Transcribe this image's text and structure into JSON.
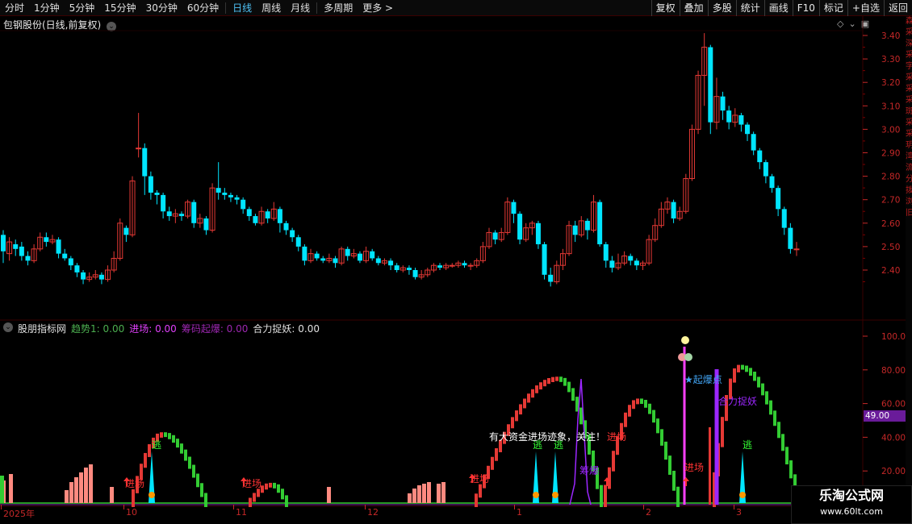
{
  "toolbar": {
    "tabs": [
      "分时",
      "1分钟",
      "5分钟",
      "15分钟",
      "30分钟",
      "60分钟",
      "日线",
      "周线",
      "月线",
      "多周期",
      "更多 >"
    ],
    "active_tab": "日线",
    "right_buttons": [
      "复权",
      "叠加",
      "多股",
      "统计",
      "画线",
      "F10",
      "标记",
      "+自选",
      "返回"
    ]
  },
  "stock": {
    "title": "包钢股份(日线,前复权)"
  },
  "price_axis": [
    "3.40",
    "3.30",
    "3.20",
    "3.10",
    "3.00",
    "2.90",
    "2.80",
    "2.70",
    "2.60",
    "2.50",
    "2.40"
  ],
  "indicator": {
    "name": "股朋指标网",
    "fields": [
      {
        "label": "趋势1: 0.00",
        "color": "#4caf50"
      },
      {
        "label": "进场: 0.00",
        "color": "#e040fb"
      },
      {
        "label": "筹码起爆: 0.00",
        "color": "#9c27b0"
      },
      {
        "label": "合力捉妖: 0.00",
        "color": "#e0e0e0"
      }
    ],
    "axis": [
      "100.0",
      "80.00",
      "60.00",
      "40.00",
      "20.00"
    ],
    "current_value": "49.00",
    "annotations": {
      "escape": "逃",
      "enter": "进场",
      "chip": "筹爆",
      "qibao": "★起爆点",
      "helizhuoyao": "合力捉妖",
      "message_white": "有大资金进场迹象，关注！",
      "message_red": "进场"
    }
  },
  "dates": [
    "2025年",
    "10",
    "11",
    "12",
    "1",
    "2",
    "3"
  ],
  "right_strip": [
    "森",
    "采",
    "深",
    "采",
    "字",
    "采",
    "采",
    "采",
    "斑",
    "采",
    "采",
    "玥",
    "湾",
    "流",
    "分",
    "拨",
    "浏",
    "旧"
  ],
  "watermark": {
    "line1": "乐淘公式网",
    "line2": "www.60lt.com"
  },
  "colors": {
    "up": "#e53935",
    "down": "#00e5ff",
    "grid": "#3a0000",
    "trend_up": "#e53935",
    "trend_down": "#33cc33"
  },
  "chart_data": {
    "type": "candlestick",
    "price_range": [
      2.35,
      3.45
    ],
    "candles": [
      [
        2.55,
        2.48,
        2.57,
        2.43
      ],
      [
        2.47,
        2.52,
        2.54,
        2.44
      ],
      [
        2.51,
        2.49,
        2.53,
        2.46
      ],
      [
        2.5,
        2.46,
        2.52,
        2.44
      ],
      [
        2.46,
        2.44,
        2.48,
        2.42
      ],
      [
        2.44,
        2.49,
        2.51,
        2.43
      ],
      [
        2.49,
        2.54,
        2.56,
        2.48
      ],
      [
        2.54,
        2.52,
        2.56,
        2.5
      ],
      [
        2.52,
        2.53,
        2.55,
        2.51
      ],
      [
        2.53,
        2.47,
        2.54,
        2.45
      ],
      [
        2.47,
        2.45,
        2.49,
        2.44
      ],
      [
        2.45,
        2.42,
        2.46,
        2.4
      ],
      [
        2.42,
        2.39,
        2.43,
        2.37
      ],
      [
        2.39,
        2.36,
        2.4,
        2.34
      ],
      [
        2.36,
        2.37,
        2.39,
        2.35
      ],
      [
        2.37,
        2.38,
        2.4,
        2.36
      ],
      [
        2.38,
        2.36,
        2.39,
        2.34
      ],
      [
        2.36,
        2.4,
        2.42,
        2.35
      ],
      [
        2.4,
        2.45,
        2.48,
        2.39
      ],
      [
        2.45,
        2.6,
        2.62,
        2.44
      ],
      [
        2.58,
        2.55,
        2.59,
        2.52
      ],
      [
        2.55,
        2.78,
        2.8,
        2.54
      ],
      [
        2.92,
        2.92,
        3.07,
        2.88
      ],
      [
        2.92,
        2.8,
        2.94,
        2.72
      ],
      [
        2.8,
        2.73,
        2.82,
        2.7
      ],
      [
        2.73,
        2.72,
        2.74,
        2.68
      ],
      [
        2.72,
        2.65,
        2.73,
        2.62
      ],
      [
        2.65,
        2.63,
        2.67,
        2.61
      ],
      [
        2.63,
        2.64,
        2.66,
        2.6
      ],
      [
        2.64,
        2.63,
        2.65,
        2.61
      ],
      [
        2.63,
        2.69,
        2.7,
        2.62
      ],
      [
        2.69,
        2.6,
        2.7,
        2.58
      ],
      [
        2.6,
        2.62,
        2.64,
        2.58
      ],
      [
        2.62,
        2.57,
        2.63,
        2.55
      ],
      [
        2.57,
        2.75,
        2.77,
        2.56
      ],
      [
        2.75,
        2.73,
        2.86,
        2.7
      ],
      [
        2.73,
        2.72,
        2.75,
        2.7
      ],
      [
        2.72,
        2.71,
        2.73,
        2.69
      ],
      [
        2.71,
        2.7,
        2.72,
        2.68
      ],
      [
        2.7,
        2.66,
        2.71,
        2.64
      ],
      [
        2.66,
        2.63,
        2.67,
        2.61
      ],
      [
        2.63,
        2.6,
        2.64,
        2.59
      ],
      [
        2.6,
        2.65,
        2.67,
        2.59
      ],
      [
        2.65,
        2.62,
        2.66,
        2.6
      ],
      [
        2.62,
        2.66,
        2.69,
        2.61
      ],
      [
        2.66,
        2.6,
        2.67,
        2.56
      ],
      [
        2.6,
        2.57,
        2.61,
        2.55
      ],
      [
        2.57,
        2.54,
        2.58,
        2.52
      ],
      [
        2.54,
        2.5,
        2.55,
        2.48
      ],
      [
        2.5,
        2.44,
        2.51,
        2.42
      ],
      [
        2.44,
        2.47,
        2.49,
        2.43
      ],
      [
        2.47,
        2.45,
        2.48,
        2.44
      ],
      [
        2.45,
        2.44,
        2.46,
        2.43
      ],
      [
        2.44,
        2.45,
        2.47,
        2.43
      ],
      [
        2.45,
        2.43,
        2.46,
        2.41
      ],
      [
        2.43,
        2.49,
        2.5,
        2.42
      ],
      [
        2.49,
        2.46,
        2.5,
        2.44
      ],
      [
        2.46,
        2.47,
        2.49,
        2.45
      ],
      [
        2.47,
        2.44,
        2.48,
        2.43
      ],
      [
        2.44,
        2.48,
        2.5,
        2.43
      ],
      [
        2.48,
        2.45,
        2.49,
        2.44
      ],
      [
        2.45,
        2.43,
        2.46,
        2.42
      ],
      [
        2.43,
        2.44,
        2.45,
        2.42
      ],
      [
        2.44,
        2.42,
        2.45,
        2.4
      ],
      [
        2.42,
        2.4,
        2.43,
        2.39
      ],
      [
        2.4,
        2.41,
        2.42,
        2.39
      ],
      [
        2.41,
        2.4,
        2.42,
        2.38
      ],
      [
        2.4,
        2.37,
        2.41,
        2.36
      ],
      [
        2.37,
        2.38,
        2.4,
        2.36
      ],
      [
        2.38,
        2.4,
        2.41,
        2.37
      ],
      [
        2.4,
        2.42,
        2.43,
        2.39
      ],
      [
        2.42,
        2.41,
        2.43,
        2.4
      ],
      [
        2.41,
        2.42,
        2.43,
        2.4
      ],
      [
        2.42,
        2.42,
        2.43,
        2.41
      ],
      [
        2.42,
        2.43,
        2.44,
        2.41
      ],
      [
        2.43,
        2.42,
        2.44,
        2.41
      ],
      [
        2.42,
        2.42,
        2.43,
        2.4
      ],
      [
        2.42,
        2.44,
        2.45,
        2.41
      ],
      [
        2.44,
        2.5,
        2.52,
        2.43
      ],
      [
        2.5,
        2.56,
        2.58,
        2.49
      ],
      [
        2.56,
        2.53,
        2.57,
        2.51
      ],
      [
        2.53,
        2.56,
        2.58,
        2.52
      ],
      [
        2.56,
        2.69,
        2.71,
        2.55
      ],
      [
        2.69,
        2.64,
        2.7,
        2.6
      ],
      [
        2.64,
        2.53,
        2.65,
        2.51
      ],
      [
        2.53,
        2.58,
        2.6,
        2.52
      ],
      [
        2.58,
        2.6,
        2.61,
        2.55
      ],
      [
        2.6,
        2.51,
        2.61,
        2.49
      ],
      [
        2.51,
        2.38,
        2.52,
        2.36
      ],
      [
        2.38,
        2.35,
        2.41,
        2.33
      ],
      [
        2.35,
        2.42,
        2.44,
        2.34
      ],
      [
        2.42,
        2.47,
        2.49,
        2.4
      ],
      [
        2.47,
        2.59,
        2.61,
        2.46
      ],
      [
        2.59,
        2.55,
        2.61,
        2.52
      ],
      [
        2.55,
        2.61,
        2.63,
        2.54
      ],
      [
        2.61,
        2.57,
        2.62,
        2.53
      ],
      [
        2.57,
        2.69,
        2.72,
        2.56
      ],
      [
        2.69,
        2.51,
        2.7,
        2.5
      ],
      [
        2.51,
        2.44,
        2.52,
        2.41
      ],
      [
        2.44,
        2.41,
        2.46,
        2.39
      ],
      [
        2.41,
        2.43,
        2.47,
        2.4
      ],
      [
        2.43,
        2.46,
        2.48,
        2.42
      ],
      [
        2.46,
        2.44,
        2.47,
        2.42
      ],
      [
        2.44,
        2.42,
        2.45,
        2.4
      ],
      [
        2.42,
        2.43,
        2.44,
        2.4
      ],
      [
        2.43,
        2.53,
        2.55,
        2.42
      ],
      [
        2.53,
        2.59,
        2.62,
        2.52
      ],
      [
        2.59,
        2.66,
        2.69,
        2.58
      ],
      [
        2.66,
        2.69,
        2.71,
        2.64
      ],
      [
        2.69,
        2.62,
        2.7,
        2.6
      ],
      [
        2.62,
        2.65,
        2.67,
        2.61
      ],
      [
        2.65,
        2.79,
        2.81,
        2.64
      ],
      [
        2.79,
        3.0,
        3.02,
        2.78
      ],
      [
        3.0,
        3.23,
        3.25,
        2.98
      ],
      [
        3.23,
        3.35,
        3.41,
        3.1
      ],
      [
        3.35,
        3.03,
        3.36,
        2.98
      ],
      [
        3.03,
        3.14,
        3.22,
        3.0
      ],
      [
        3.14,
        3.08,
        3.16,
        3.04
      ],
      [
        3.08,
        3.03,
        3.1,
        3.0
      ],
      [
        3.03,
        3.06,
        3.09,
        3.01
      ],
      [
        3.06,
        3.02,
        3.07,
        2.99
      ],
      [
        3.02,
        2.98,
        3.03,
        2.95
      ],
      [
        2.98,
        2.91,
        2.99,
        2.89
      ],
      [
        2.91,
        2.86,
        2.92,
        2.83
      ],
      [
        2.86,
        2.8,
        2.87,
        2.77
      ],
      [
        2.8,
        2.75,
        2.81,
        2.73
      ],
      [
        2.75,
        2.66,
        2.76,
        2.63
      ],
      [
        2.66,
        2.58,
        2.67,
        2.55
      ],
      [
        2.58,
        2.49,
        2.6,
        2.47
      ],
      [
        2.49,
        2.49,
        2.52,
        2.46
      ]
    ]
  }
}
